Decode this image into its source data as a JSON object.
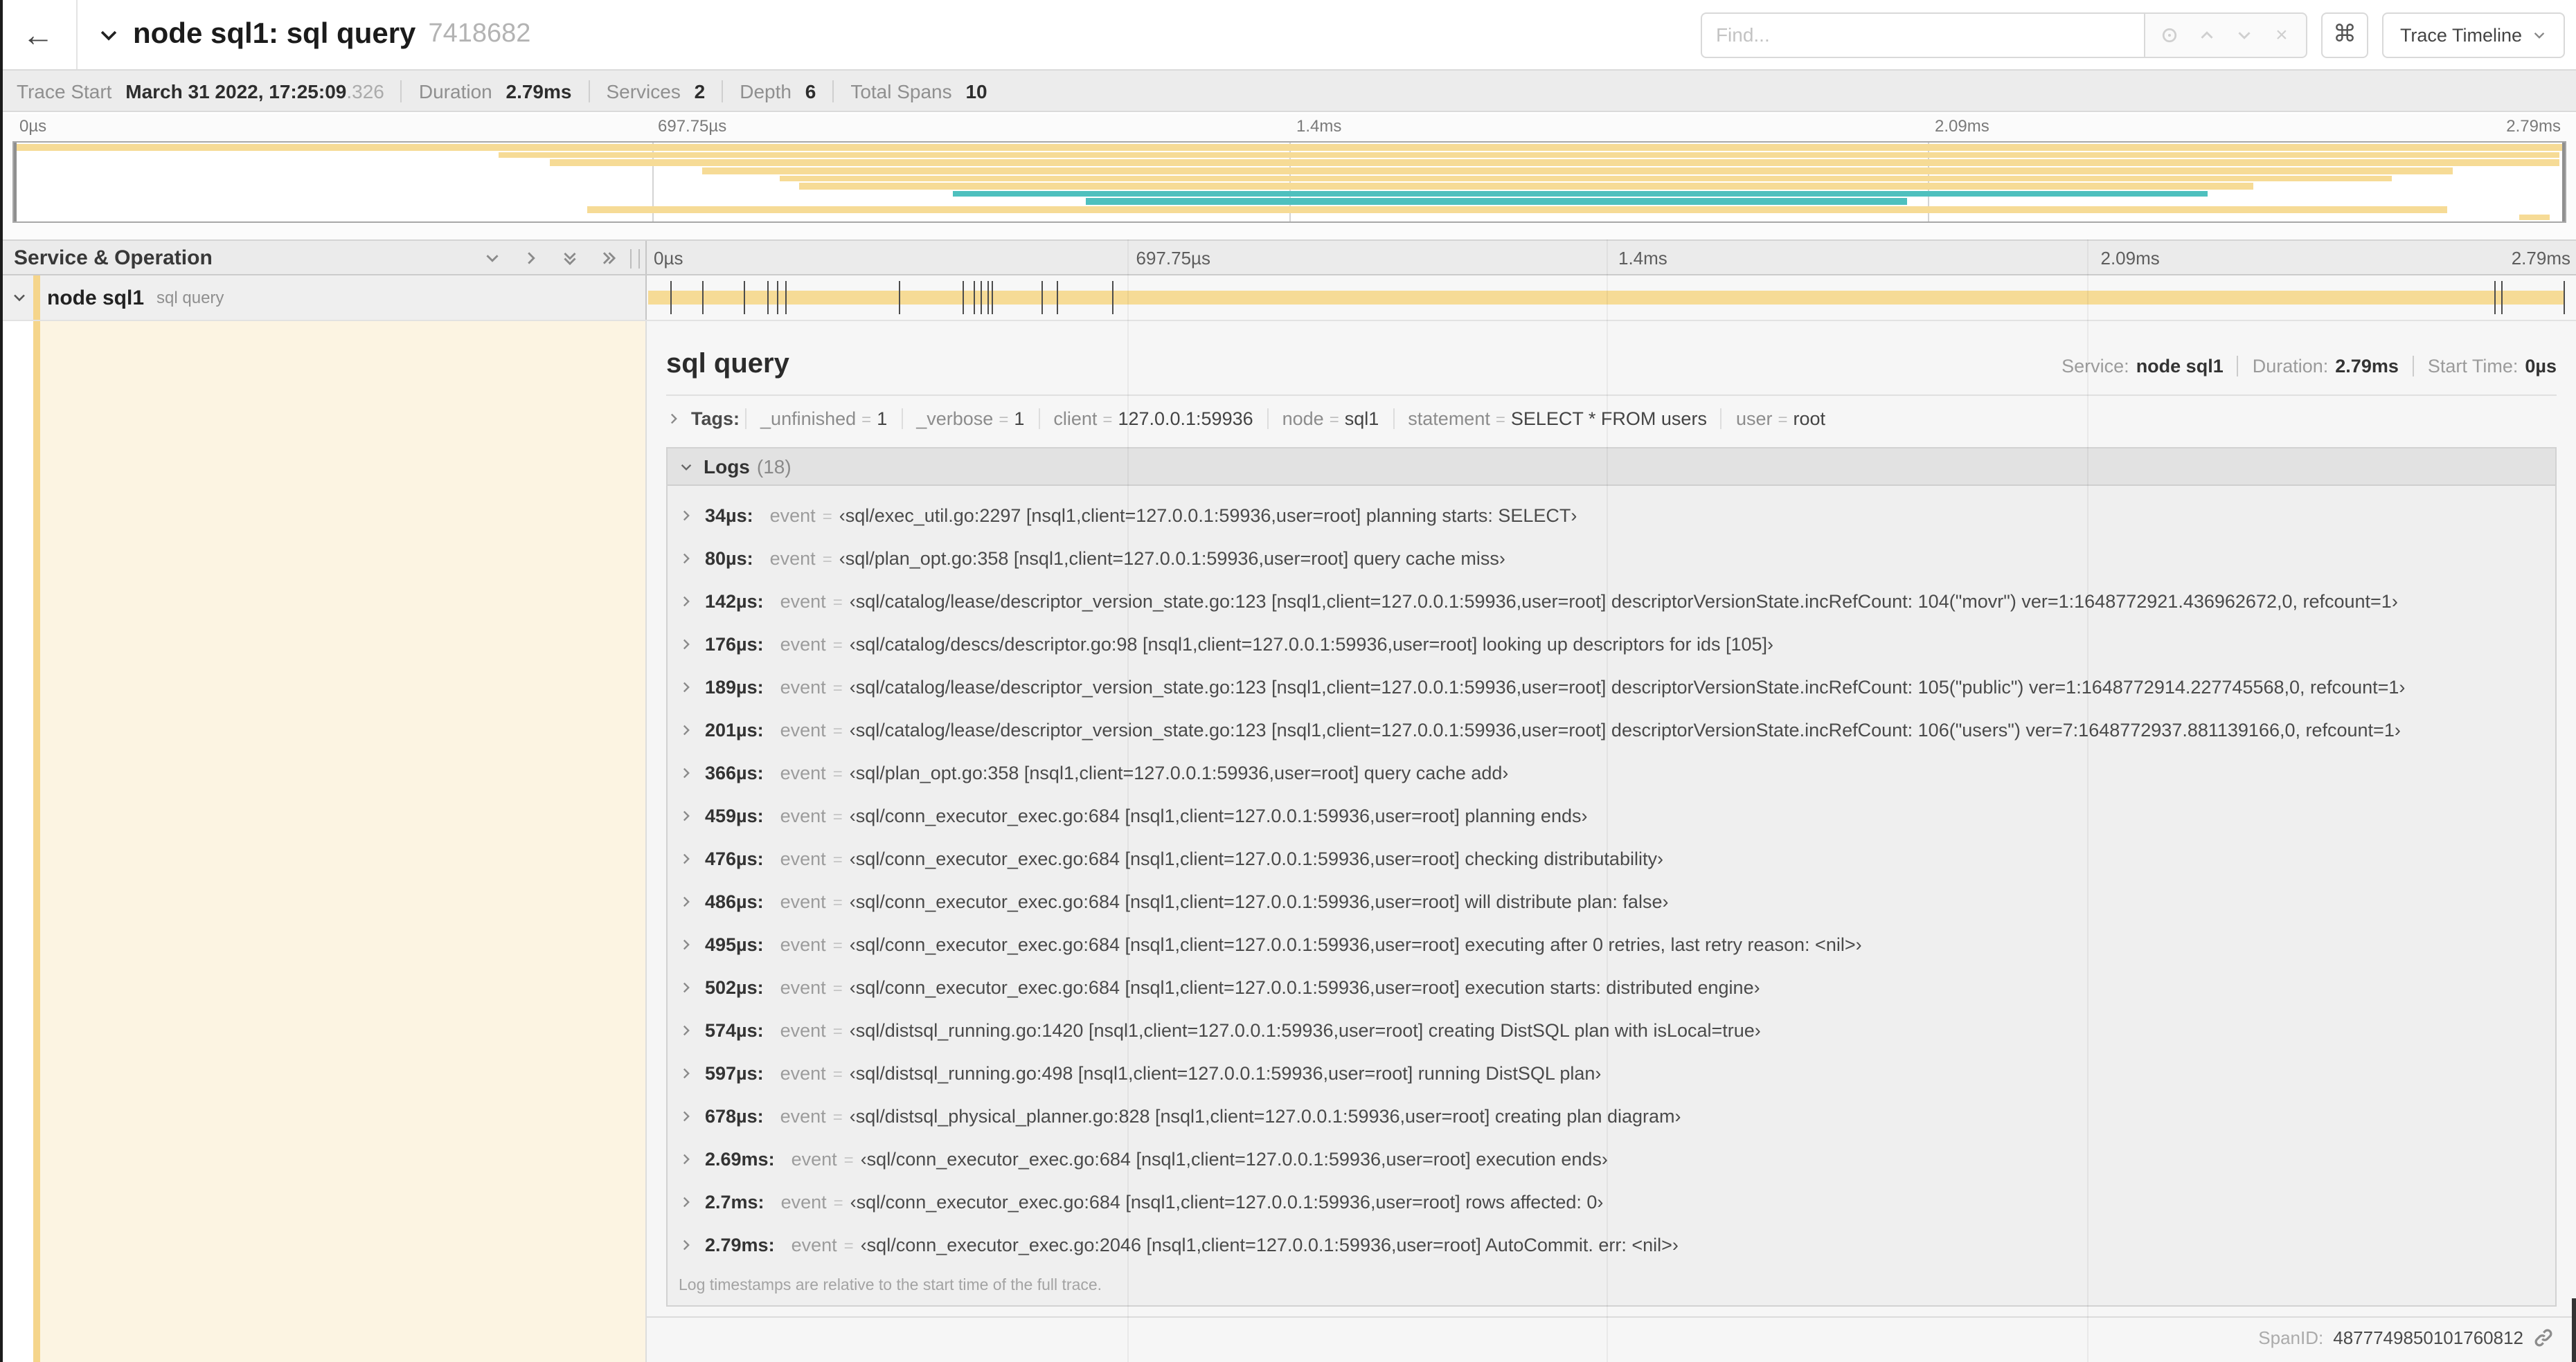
{
  "header": {
    "back_icon": "←",
    "title": "node sql1: sql query",
    "trace_id": "7418682",
    "find_placeholder": "Find...",
    "command_icon": "⌘",
    "view_selector": "Trace Timeline"
  },
  "summary": {
    "items": [
      {
        "label": "Trace Start",
        "value": "March 31 2022, 17:25:09",
        "suffix": ".326"
      },
      {
        "label": "Duration",
        "value": "2.79ms",
        "suffix": ""
      },
      {
        "label": "Services",
        "value": "2",
        "suffix": ""
      },
      {
        "label": "Depth",
        "value": "6",
        "suffix": ""
      },
      {
        "label": "Total Spans",
        "value": "10",
        "suffix": ""
      }
    ]
  },
  "ruler": {
    "ticks": [
      {
        "label": "0µs",
        "f": 0
      },
      {
        "label": "697.75µs",
        "f": 0.25
      },
      {
        "label": "1.4ms",
        "f": 0.5
      },
      {
        "label": "2.09ms",
        "f": 0.75
      },
      {
        "label": "2.79ms",
        "f": 1
      }
    ]
  },
  "minimap": {
    "spans": [
      {
        "start": 0.0,
        "end": 1.0,
        "color": "tan"
      },
      {
        "start": 0.19,
        "end": 0.998,
        "color": "tan"
      },
      {
        "start": 0.21,
        "end": 0.998,
        "color": "tan"
      },
      {
        "start": 0.27,
        "end": 0.956,
        "color": "tan"
      },
      {
        "start": 0.3,
        "end": 0.932,
        "color": "tan"
      },
      {
        "start": 0.308,
        "end": 0.878,
        "color": "tan"
      },
      {
        "start": 0.368,
        "end": 0.86,
        "color": "teal"
      },
      {
        "start": 0.42,
        "end": 0.742,
        "color": "teal"
      },
      {
        "start": 0.225,
        "end": 0.954,
        "color": "tan"
      },
      {
        "start": 0.982,
        "end": 0.994,
        "color": "tan"
      }
    ]
  },
  "timeline": {
    "left_header": "Service & Operation",
    "duration_us": 2790
  },
  "span_row": {
    "service": "node sql1",
    "operation": "sql query"
  },
  "detail": {
    "title": "sql query",
    "meta": [
      {
        "label": "Service:",
        "value": "node sql1"
      },
      {
        "label": "Duration:",
        "value": "2.79ms"
      },
      {
        "label": "Start Time:",
        "value": "0µs"
      }
    ],
    "tags_label": "Tags:",
    "tags": [
      {
        "key": "_unfinished",
        "value": "1"
      },
      {
        "key": "_verbose",
        "value": "1"
      },
      {
        "key": "client",
        "value": "127.0.0.1:59936"
      },
      {
        "key": "node",
        "value": "sql1"
      },
      {
        "key": "statement",
        "value": "SELECT * FROM users"
      },
      {
        "key": "user",
        "value": "root"
      }
    ],
    "logs_label": "Logs",
    "logs_count": "(18)",
    "logs": [
      {
        "t": 34,
        "time": "34µs:",
        "key": "event",
        "value": "‹sql/exec_util.go:2297 [nsql1,client=127.0.0.1:59936,user=root] planning starts: SELECT›"
      },
      {
        "t": 80,
        "time": "80µs:",
        "key": "event",
        "value": "‹sql/plan_opt.go:358 [nsql1,client=127.0.0.1:59936,user=root] query cache miss›"
      },
      {
        "t": 142,
        "time": "142µs:",
        "key": "event",
        "value": "‹sql/catalog/lease/descriptor_version_state.go:123 [nsql1,client=127.0.0.1:59936,user=root] descriptorVersionState.incRefCount: 104(\"movr\") ver=1:1648772921.436962672,0, refcount=1›"
      },
      {
        "t": 176,
        "time": "176µs:",
        "key": "event",
        "value": "‹sql/catalog/descs/descriptor.go:98 [nsql1,client=127.0.0.1:59936,user=root] looking up descriptors for ids [105]›"
      },
      {
        "t": 189,
        "time": "189µs:",
        "key": "event",
        "value": "‹sql/catalog/lease/descriptor_version_state.go:123 [nsql1,client=127.0.0.1:59936,user=root] descriptorVersionState.incRefCount: 105(\"public\") ver=1:1648772914.227745568,0, refcount=1›"
      },
      {
        "t": 201,
        "time": "201µs:",
        "key": "event",
        "value": "‹sql/catalog/lease/descriptor_version_state.go:123 [nsql1,client=127.0.0.1:59936,user=root] descriptorVersionState.incRefCount: 106(\"users\") ver=7:1648772937.881139166,0, refcount=1›"
      },
      {
        "t": 366,
        "time": "366µs:",
        "key": "event",
        "value": "‹sql/plan_opt.go:358 [nsql1,client=127.0.0.1:59936,user=root] query cache add›"
      },
      {
        "t": 459,
        "time": "459µs:",
        "key": "event",
        "value": "‹sql/conn_executor_exec.go:684 [nsql1,client=127.0.0.1:59936,user=root] planning ends›"
      },
      {
        "t": 476,
        "time": "476µs:",
        "key": "event",
        "value": "‹sql/conn_executor_exec.go:684 [nsql1,client=127.0.0.1:59936,user=root] checking distributability›"
      },
      {
        "t": 486,
        "time": "486µs:",
        "key": "event",
        "value": "‹sql/conn_executor_exec.go:684 [nsql1,client=127.0.0.1:59936,user=root] will distribute plan: false›"
      },
      {
        "t": 495,
        "time": "495µs:",
        "key": "event",
        "value": "‹sql/conn_executor_exec.go:684 [nsql1,client=127.0.0.1:59936,user=root] executing after 0 retries, last retry reason: <nil>›"
      },
      {
        "t": 502,
        "time": "502µs:",
        "key": "event",
        "value": "‹sql/conn_executor_exec.go:684 [nsql1,client=127.0.0.1:59936,user=root] execution starts: distributed engine›"
      },
      {
        "t": 574,
        "time": "574µs:",
        "key": "event",
        "value": "‹sql/distsql_running.go:1420 [nsql1,client=127.0.0.1:59936,user=root] creating DistSQL plan with isLocal=true›"
      },
      {
        "t": 597,
        "time": "597µs:",
        "key": "event",
        "value": "‹sql/distsql_running.go:498 [nsql1,client=127.0.0.1:59936,user=root] running DistSQL plan›"
      },
      {
        "t": 678,
        "time": "678µs:",
        "key": "event",
        "value": "‹sql/distsql_physical_planner.go:828 [nsql1,client=127.0.0.1:59936,user=root] creating plan diagram›"
      },
      {
        "t": 2690,
        "time": "2.69ms:",
        "key": "event",
        "value": "‹sql/conn_executor_exec.go:684 [nsql1,client=127.0.0.1:59936,user=root] execution ends›"
      },
      {
        "t": 2700,
        "time": "2.7ms:",
        "key": "event",
        "value": "‹sql/conn_executor_exec.go:684 [nsql1,client=127.0.0.1:59936,user=root] rows affected: 0›"
      },
      {
        "t": 2790,
        "time": "2.79ms:",
        "key": "event",
        "value": "‹sql/conn_executor_exec.go:2046 [nsql1,client=127.0.0.1:59936,user=root] AutoCommit. err: <nil>›"
      }
    ],
    "footer_note": "Log timestamps are relative to the start time of the full trace.",
    "span_id_label": "SpanID:",
    "span_id": "4877749850101760812"
  },
  "colors": {
    "tan": "#F6DB96",
    "teal": "#4EC0BE",
    "stripe": "#F5D58B",
    "cream": "#FCF4E2",
    "tick": "#4c4c4c"
  }
}
